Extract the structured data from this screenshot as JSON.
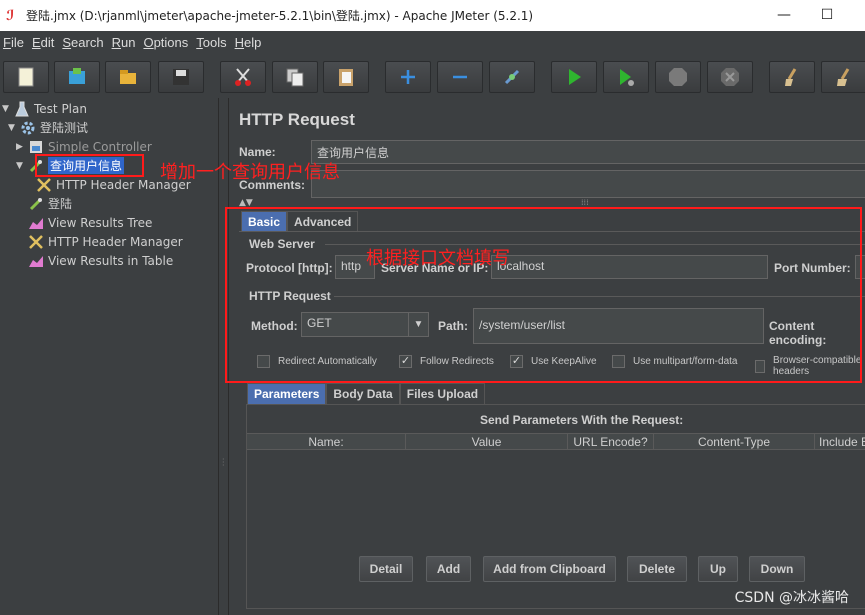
{
  "window": {
    "title": "登陆.jmx (D:\\rjanml\\jmeter\\apache-jmeter-5.2.1\\bin\\登陆.jmx) - Apache JMeter (5.2.1)",
    "minimize": "—",
    "maximize": "☐"
  },
  "menubar": {
    "items": [
      {
        "u": "F",
        "rest": "ile"
      },
      {
        "u": "E",
        "rest": "dit"
      },
      {
        "u": "S",
        "rest": "earch"
      },
      {
        "u": "R",
        "rest": "un"
      },
      {
        "u": "O",
        "rest": "ptions"
      },
      {
        "u": "T",
        "rest": "ools"
      },
      {
        "u": "H",
        "rest": "elp"
      }
    ]
  },
  "toolbar": {
    "icons": [
      "new-icon",
      "templates-icon",
      "open-icon",
      "save-icon",
      "cut-icon",
      "copy-icon",
      "paste-icon",
      "expand-icon",
      "collapse-icon",
      "toggle-icon",
      "start-icon",
      "start-no-pause-icon",
      "stop-icon",
      "shutdown-icon",
      "clear-icon",
      "clear-all-icon"
    ]
  },
  "tree": {
    "test_plan": "Test Plan",
    "thread_group": "登陆测试",
    "simple_controller": "Simple Controller",
    "sampler_query": "查询用户信息",
    "header_manager_child": "HTTP Header Manager",
    "sampler_login": "登陆",
    "view_results_tree": "View Results Tree",
    "header_manager": "HTTP Header Manager",
    "view_results_table": "View Results in Table"
  },
  "panel": {
    "title": "HTTP Request",
    "name_label": "Name:",
    "name_value": "查询用户信息",
    "comments_label": "Comments:",
    "tabs": {
      "basic": "Basic",
      "advanced": "Advanced"
    },
    "web_server": {
      "group": "Web Server",
      "protocol_label": "Protocol [http]:",
      "protocol_value": "http",
      "server_label": "Server Name or IP:",
      "server_value": "localhost",
      "port_label": "Port Number:"
    },
    "http_request": {
      "group": "HTTP Request",
      "method_label": "Method:",
      "method_value": "GET",
      "path_label": "Path:",
      "path_value": "/system/user/list",
      "encoding_label": "Content encoding:"
    },
    "checks": [
      {
        "label": "Redirect Automatically",
        "checked": false
      },
      {
        "label": "Follow Redirects",
        "checked": true
      },
      {
        "label": "Use KeepAlive",
        "checked": true
      },
      {
        "label": "Use multipart/form-data",
        "checked": false
      },
      {
        "label": "Browser-compatible headers",
        "checked": false
      }
    ],
    "param_tabs": {
      "parameters": "Parameters",
      "body": "Body Data",
      "files": "Files Upload"
    },
    "send_params": "Send Parameters With the Request:",
    "columns": [
      "Name:",
      "Value",
      "URL Encode?",
      "Content-Type",
      "Include Equals?"
    ],
    "buttons": {
      "detail": "Detail",
      "add": "Add",
      "clipboard": "Add from Clipboard",
      "delete": "Delete",
      "up": "Up",
      "down": "Down"
    }
  },
  "annotations": {
    "add_query": "增加一个查询用户信息",
    "fill_doc": "根据接口文档填写",
    "watermark": "CSDN @冰冰酱哈"
  }
}
